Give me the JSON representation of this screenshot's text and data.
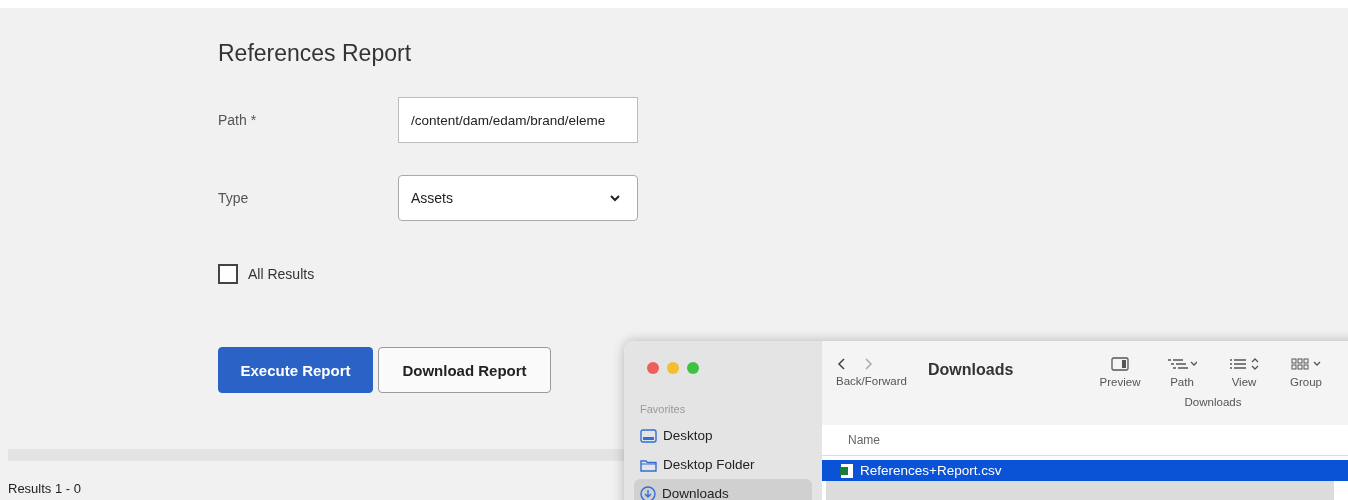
{
  "form": {
    "title": "References Report",
    "path": {
      "label": "Path *",
      "value": "/content/dam/edam/brand/eleme"
    },
    "type": {
      "label": "Type",
      "value": "Assets"
    },
    "all_results": {
      "label": "All Results",
      "checked": false
    },
    "buttons": [
      {
        "label": "Execute Report",
        "kind": "primary"
      },
      {
        "label": "Download Report",
        "kind": "secondary"
      }
    ]
  },
  "results": "Results 1 - 0",
  "finder": {
    "nav_label": "Back/Forward",
    "title": "Downloads",
    "toolbar": [
      {
        "label": "Preview",
        "kind": "preview"
      },
      {
        "label": "Path",
        "kind": "path"
      },
      {
        "label": "View",
        "kind": "view"
      },
      {
        "label": "Group",
        "kind": "group"
      }
    ],
    "toolbar_group_label": "Downloads",
    "sidebar": {
      "section": "Favorites",
      "items": [
        {
          "label": "Desktop",
          "kind": "desktop",
          "selected": false
        },
        {
          "label": "Desktop Folder",
          "kind": "folder",
          "selected": false
        },
        {
          "label": "Downloads",
          "kind": "downloads",
          "selected": true
        }
      ]
    },
    "column": "Name",
    "files": [
      {
        "name": "References+Report.csv",
        "selected": true
      }
    ]
  }
}
